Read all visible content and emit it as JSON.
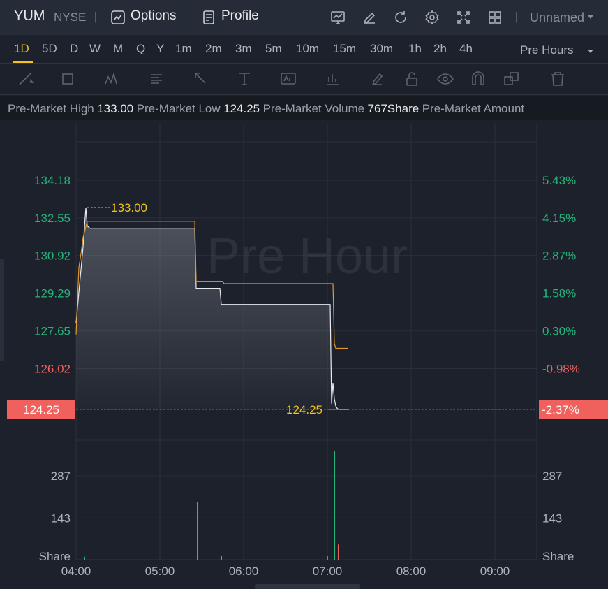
{
  "header": {
    "symbol": "YUM",
    "exchange": "NYSE",
    "separator": "|",
    "options_label": "Options",
    "profile_label": "Profile",
    "layout_name": "Unnamed"
  },
  "periods": {
    "items": [
      "1D",
      "5D",
      "D",
      "W",
      "M",
      "Q",
      "Y",
      "1m",
      "2m",
      "3m",
      "5m",
      "10m",
      "15m",
      "30m",
      "1h",
      "2h",
      "4h"
    ],
    "active": "1D",
    "session_label": "Pre Hours"
  },
  "info": {
    "high_label": "Pre-Market High",
    "high_value": "133.00",
    "low_label": "Pre-Market Low",
    "low_value": "124.25",
    "volume_label": "Pre-Market Volume",
    "volume_value": "767Share",
    "amount_label": "Pre-Market Amount"
  },
  "colors": {
    "up": "#26b37a",
    "down": "#f0605d",
    "price_line": "#e8eaee",
    "avg_line": "#e59a2b",
    "marker": "#f0c419"
  },
  "chart_data": {
    "type": "line",
    "watermark": "Pre Hour",
    "x_ticks": [
      "04:00",
      "05:00",
      "06:00",
      "07:00",
      "08:00",
      "09:00"
    ],
    "price_axis_left": [
      "134.18",
      "132.55",
      "130.92",
      "129.29",
      "127.65",
      "126.02"
    ],
    "price_axis_right": [
      "5.43%",
      "4.15%",
      "2.87%",
      "1.58%",
      "0.30%",
      "-0.98%"
    ],
    "price_ylim": [
      124.25,
      134.18
    ],
    "current_price": "124.25",
    "current_change": "-2.37%",
    "high_marker": "133.00",
    "low_marker": "124.25",
    "series": [
      {
        "name": "Price",
        "x": [
          "04:00",
          "04:05",
          "04:07",
          "04:08",
          "04:10",
          "05:25",
          "05:26",
          "05:43",
          "05:44",
          "07:02",
          "07:03",
          "07:04",
          "07:05",
          "07:06",
          "07:07",
          "07:08",
          "07:15"
        ],
        "y": [
          128.0,
          131.3,
          133.0,
          132.2,
          132.1,
          132.1,
          129.5,
          129.5,
          128.8,
          128.8,
          124.5,
          125.4,
          124.7,
          124.4,
          124.3,
          124.25,
          124.25
        ]
      },
      {
        "name": "Average",
        "x": [
          "04:00",
          "04:02",
          "04:04",
          "04:05",
          "04:08",
          "05:25",
          "05:26",
          "05:45",
          "05:46",
          "07:04",
          "07:05",
          "07:06",
          "07:15"
        ],
        "y": [
          127.5,
          130.4,
          131.2,
          131.7,
          132.4,
          132.4,
          129.8,
          129.8,
          129.7,
          129.7,
          127.1,
          126.9,
          126.9
        ]
      }
    ],
    "volume_axis_left": [
      "287",
      "143",
      "Share"
    ],
    "volume_axis_right": [
      "287",
      "143",
      "Share"
    ],
    "volume_ylim": [
      0,
      400
    ],
    "volume_bars": [
      {
        "x": "04:06",
        "value": 10,
        "dir": "up"
      },
      {
        "x": "05:27",
        "value": 198,
        "dir": "down"
      },
      {
        "x": "05:44",
        "value": 12,
        "dir": "down"
      },
      {
        "x": "07:00",
        "value": 12,
        "dir": "up"
      },
      {
        "x": "07:05",
        "value": 373,
        "dir": "up"
      },
      {
        "x": "07:08",
        "value": 52,
        "dir": "down"
      }
    ]
  }
}
